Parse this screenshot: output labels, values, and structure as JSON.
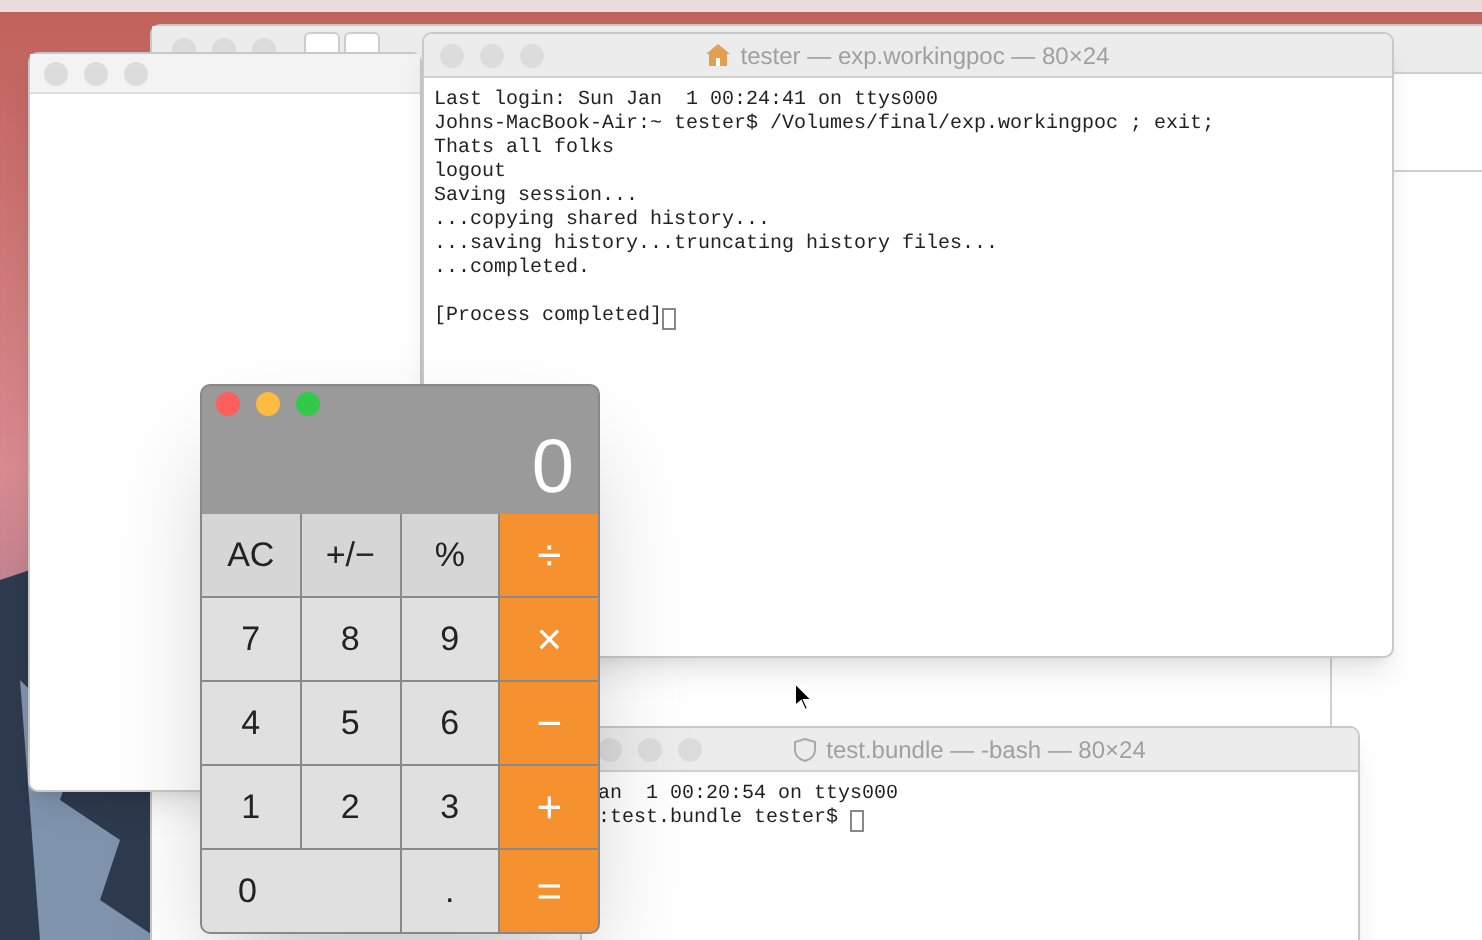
{
  "terminal_windows": [
    {
      "title": "tester — exp.workingpoc — 80×24",
      "kind": "home",
      "lines": [
        {
          "text": "Last login: Sun Jan  1 00:24:41 on ttys000",
          "kind": "plain"
        },
        {
          "text": "Johns-MacBook-Air:~ tester$ /Volumes/final/exp.workingpoc ; exit;",
          "kind": "plain"
        },
        {
          "text": "Thats all folks",
          "kind": "plain"
        },
        {
          "text": "logout",
          "kind": "plain"
        },
        {
          "text": "Saving session...",
          "kind": "plain"
        },
        {
          "text": "...copying shared history...",
          "kind": "plain"
        },
        {
          "text": "...saving history...truncating history files...",
          "kind": "plain"
        },
        {
          "text": "...completed.",
          "kind": "plain"
        },
        {
          "text": "[Process completed]",
          "kind": "spaced"
        }
      ]
    },
    {
      "title": "test.bundle — -bash — 80×24",
      "kind": "shield",
      "lines": [
        {
          "text": "an  1 00:20:54 on ttys000",
          "kind": "plain"
        },
        {
          "text": ":test.bundle tester$ ",
          "kind": "plain"
        }
      ]
    }
  ],
  "calculator": {
    "display": "0",
    "keys": [
      {
        "label": "AC",
        "kind": "function"
      },
      {
        "label": "+/−",
        "kind": "function"
      },
      {
        "label": "%",
        "kind": "function"
      },
      {
        "label": "÷",
        "kind": "operator"
      },
      {
        "label": "7",
        "kind": "digit"
      },
      {
        "label": "8",
        "kind": "digit"
      },
      {
        "label": "9",
        "kind": "digit"
      },
      {
        "label": "×",
        "kind": "operator"
      },
      {
        "label": "4",
        "kind": "digit"
      },
      {
        "label": "5",
        "kind": "digit"
      },
      {
        "label": "6",
        "kind": "digit"
      },
      {
        "label": "−",
        "kind": "operator"
      },
      {
        "label": "1",
        "kind": "digit"
      },
      {
        "label": "2",
        "kind": "digit"
      },
      {
        "label": "3",
        "kind": "digit"
      },
      {
        "label": "+",
        "kind": "operator"
      },
      {
        "label": "0",
        "kind": "wide-digit"
      },
      {
        "label": ".",
        "kind": "digit"
      },
      {
        "label": "=",
        "kind": "operator"
      }
    ]
  }
}
